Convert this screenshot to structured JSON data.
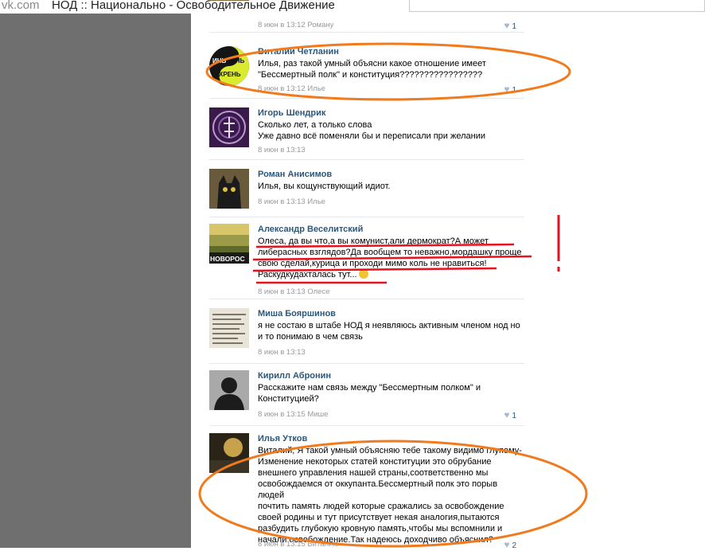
{
  "window": {
    "site": "vk.com",
    "title": "НОД :: Национально - Освободительное Движение"
  },
  "posts": [
    {
      "author": "",
      "text": "",
      "meta": "8 июн в 13:12 Роману",
      "likes": "1"
    },
    {
      "author": "Виталий Четланин",
      "text": "Илья, раз такой умный объясни какое отношение имеет\n\"Бессмертный полк\" и конституция?????????????????",
      "meta": "8 июн в 13:12 Илье",
      "likes": "1"
    },
    {
      "author": "Игорь Шендрик",
      "text": "Сколько лет, а только слова\nУже давно всё поменяли бы и переписали при желании",
      "meta": "8 июн в 13:13",
      "likes": ""
    },
    {
      "author": "Роман Анисимов",
      "text": "Илья, вы кощунствующий идиот.",
      "meta": "8 июн в 13:13 Илье",
      "likes": ""
    },
    {
      "author": "Александр Веселитский",
      "text": "Олеса, да вы что,а вы комунист,али дермократ?А может\nлиберасных взглядов?Да вообщем то неважно,мордашку проще\nсвою сделай,курица и проходи мимо коль не нравиться!\nРаскудкудахталась тут...",
      "meta": "8 июн в 13:13 Олесе",
      "likes": "",
      "avatar_caption": "НОВОРОС"
    },
    {
      "author": "Миша Бояршинов",
      "text": "я не состаю в штабе НОД я неявляюсь активным членом нод но\nи то понимаю в чем связь",
      "meta": "8 июн в 13:13",
      "likes": ""
    },
    {
      "author": "Кирилл Абронин",
      "text": "Расскажите нам связь между \"Бессмертным полком\" и\nКонституцией?",
      "meta": "8 июн в 13:15 Мише",
      "likes": "1"
    },
    {
      "author": "Илья Утков",
      "text": "Виталий, Я такой умный объясняю тебе такому видимо глупому-\nИзменение некоторых статей конституции это обрубание\nвнешнего управления нашей страны,соответственно мы\nосвобождаемся от оккупанта.Бессмертный полк это порыв людей\nпочтить память людей которые сражались за освобождение\nсвоей родины и тут присутствует некая аналогия,пытаются\nразбудить глубокую кровную память,чтобы мы вспомнили и\nначали освобождение.Так надеюсь доходчиво объяснил?",
      "meta": "8 июн в 13:15 Виталию",
      "likes": "2"
    }
  ],
  "avatars": {
    "chetlanin": [
      "ИНЬ",
      "ЯНЬ",
      "ХРЕНЬ"
    ]
  },
  "annotations": {
    "oval_color": "#f07a1e",
    "underline_color": "#e8111e",
    "mark_color": "#e8111e"
  }
}
